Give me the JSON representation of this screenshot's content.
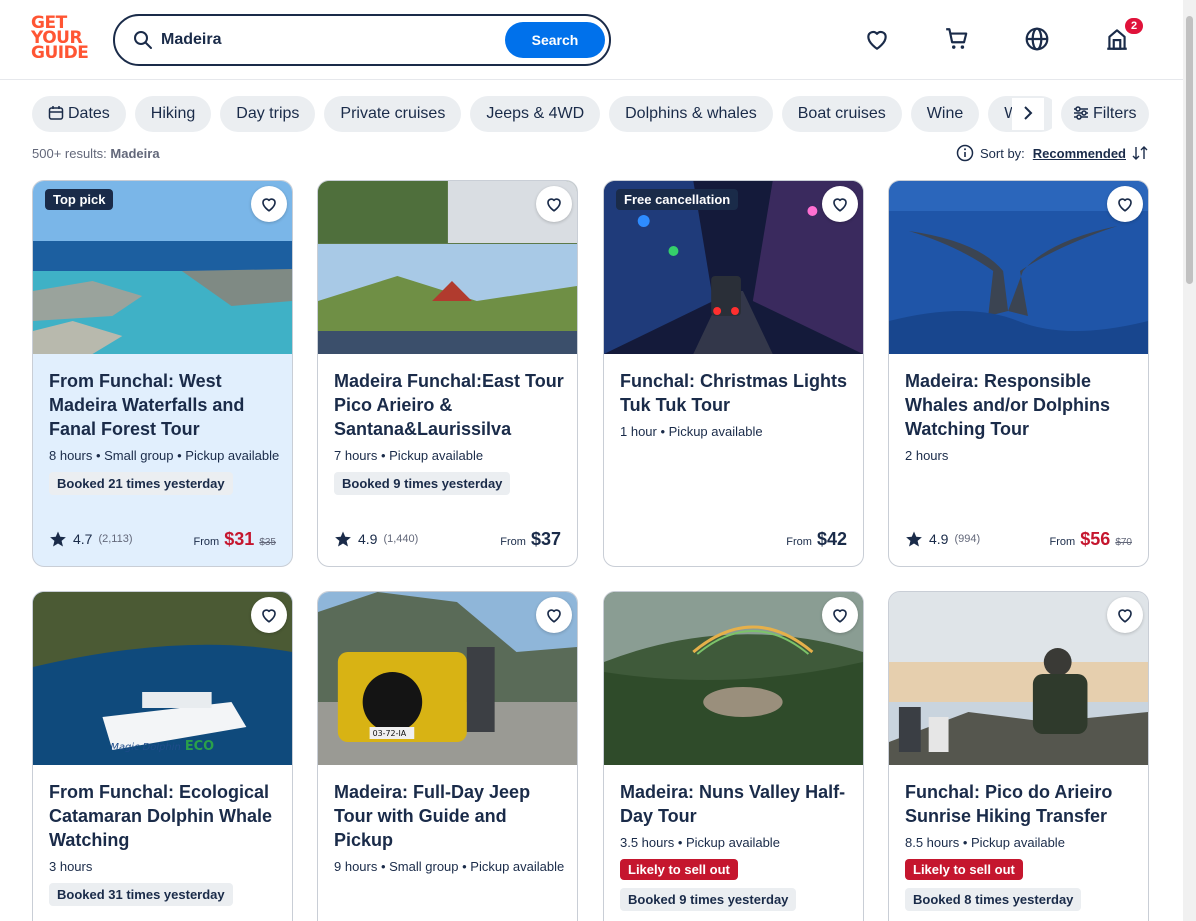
{
  "header": {
    "logo": [
      "GET",
      "YOUR",
      "GUIDE"
    ],
    "search_value": "Madeira",
    "search_button": "Search",
    "cart_badge": "2"
  },
  "chips": [
    "Dates",
    "Hiking",
    "Day trips",
    "Private cruises",
    "Jeeps & 4WD",
    "Dolphins & whales",
    "Boat cruises",
    "Wine",
    "Walki"
  ],
  "filters_label": "Filters",
  "results": {
    "count": "500+ results:",
    "query": "Madeira"
  },
  "sort": {
    "label": "Sort by:",
    "value": "Recommended"
  },
  "cards": [
    {
      "tag": "Top pick",
      "title": "From Funchal: West Madeira Waterfalls and Fanal Forest Tour",
      "meta": "8 hours • Small group • Pickup available",
      "booked": "Booked 21 times yesterday",
      "rating": "4.7",
      "count": "(2,113)",
      "from": "From",
      "price": "$31",
      "old": "$35"
    },
    {
      "title": "Madeira Funchal:East Tour Pico Arieiro & Santana&Laurissilva",
      "meta": "7 hours • Pickup available",
      "booked": "Booked 9 times yesterday",
      "rating": "4.9",
      "count": "(1,440)",
      "from": "From",
      "price": "$37"
    },
    {
      "tag": "Free cancellation",
      "title": "Funchal: Christmas Lights Tuk Tuk Tour",
      "meta": "1 hour • Pickup available",
      "from": "From",
      "price": "$42"
    },
    {
      "title": "Madeira: Responsible Whales and/or Dolphins Watching Tour",
      "meta": "2 hours",
      "rating": "4.9",
      "count": "(994)",
      "from": "From",
      "price": "$56",
      "old": "$70"
    },
    {
      "title": "From Funchal: Ecological Catamaran Dolphin Whale Watching",
      "meta": "3 hours",
      "booked": "Booked 31 times yesterday",
      "boat_text": "Magic Dolphin",
      "boat_eco": "ECO"
    },
    {
      "title": "Madeira: Full-Day Jeep Tour with Guide and Pickup",
      "meta": "9 hours • Small group • Pickup available",
      "plate": "03-72-IA"
    },
    {
      "title": "Madeira: Nuns Valley Half-Day Tour",
      "meta": "3.5 hours • Pickup available",
      "sell": "Likely to sell out",
      "booked": "Booked 9 times yesterday"
    },
    {
      "title": "Funchal: Pico do Arieiro Sunrise Hiking Transfer",
      "meta": "8.5 hours • Pickup available",
      "sell": "Likely to sell out",
      "booked": "Booked 8 times yesterday"
    }
  ],
  "colors": {
    "brand": "#ff5533",
    "accent": "#0071eb",
    "sale": "#c5162e",
    "navy": "#1a2b49"
  }
}
